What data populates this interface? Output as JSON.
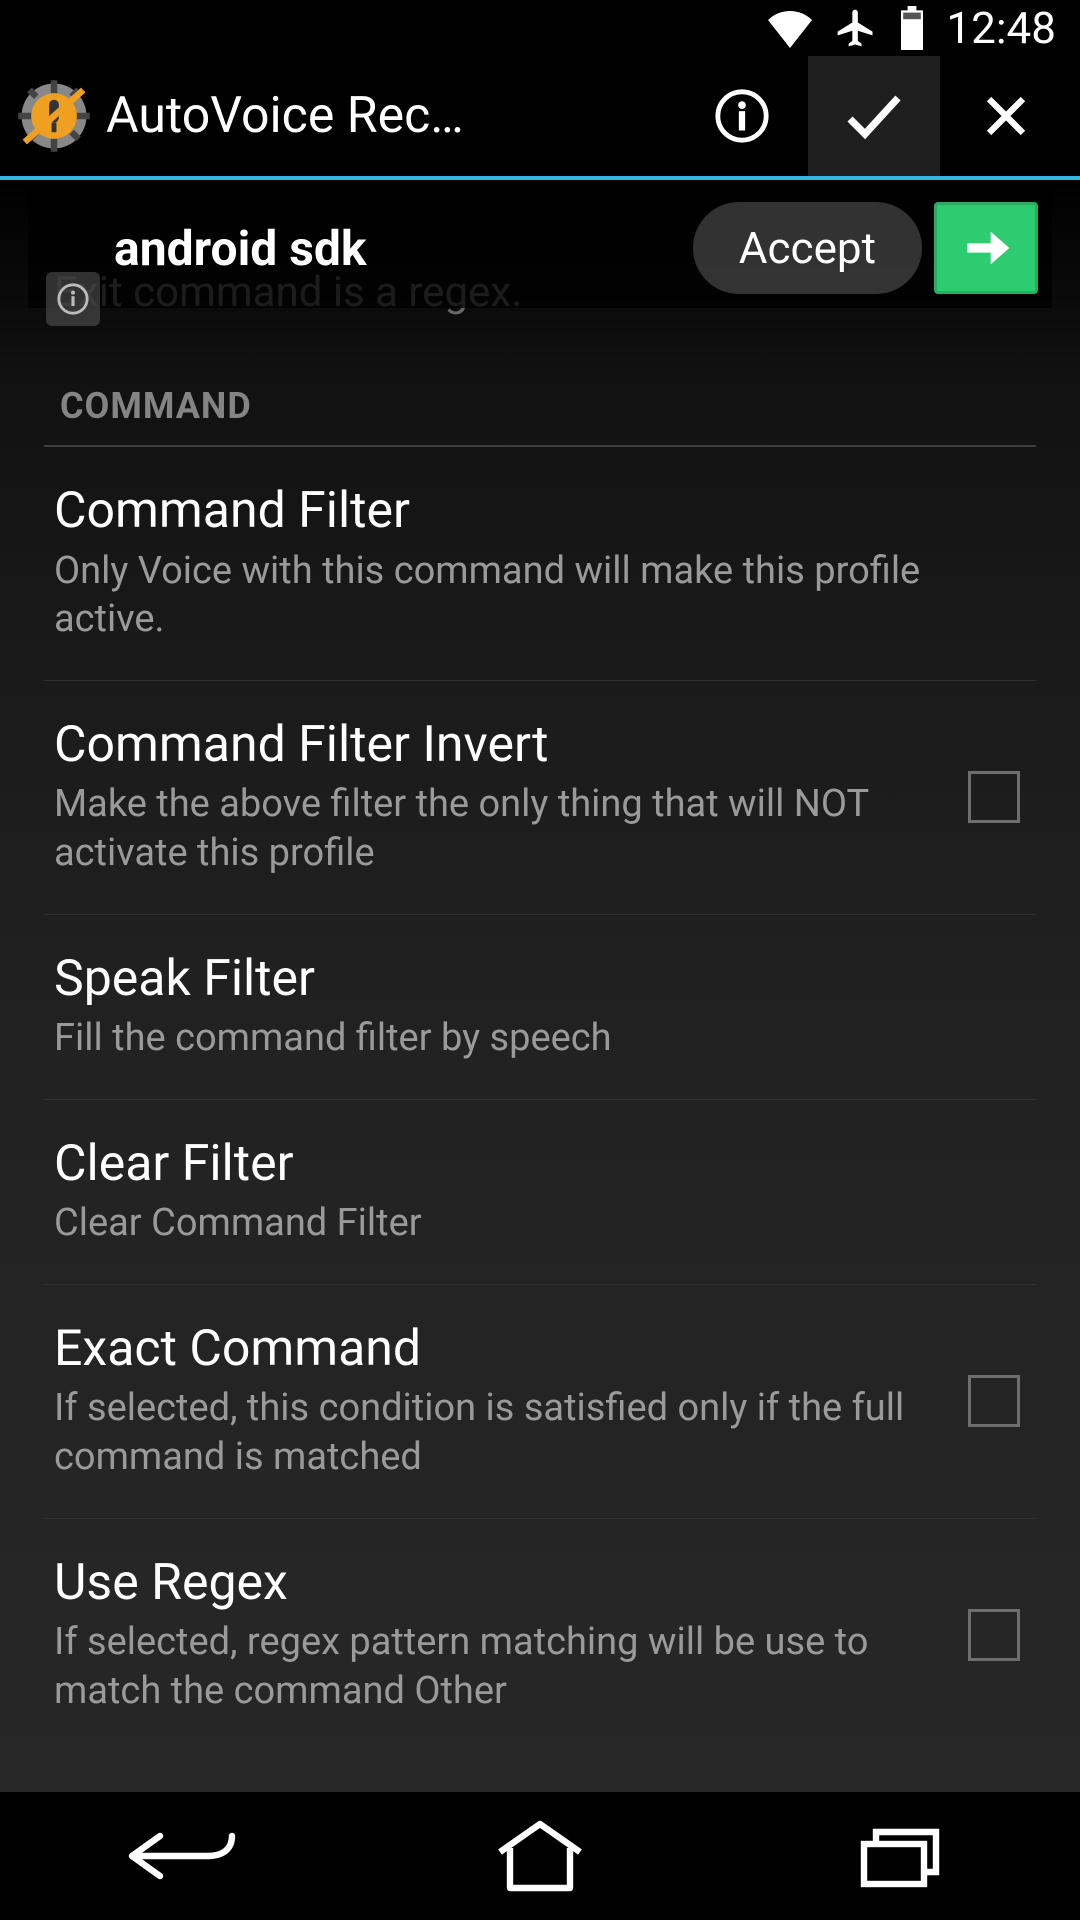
{
  "status": {
    "time": "12:48"
  },
  "actionbar": {
    "title": "AutoVoice Rec…"
  },
  "floating": {
    "text": "android sdk",
    "accept": "Accept"
  },
  "peek_line": "Exit command is a regex.",
  "section": "COMMAND",
  "items": [
    {
      "title": "Command Filter",
      "desc": "Only Voice with this command will make this profile active."
    },
    {
      "title": "Command Filter Invert",
      "desc": "Make the above filter the only thing that will NOT activate this profile"
    },
    {
      "title": "Speak Filter",
      "desc": "Fill the command filter by speech"
    },
    {
      "title": "Clear Filter",
      "desc": "Clear Command Filter"
    },
    {
      "title": "Exact Command",
      "desc": "If selected, this condition is satisfied only if the full command is matched"
    },
    {
      "title": "Use Regex",
      "desc": "If selected, regex pattern matching will be use to match the command Other"
    }
  ]
}
